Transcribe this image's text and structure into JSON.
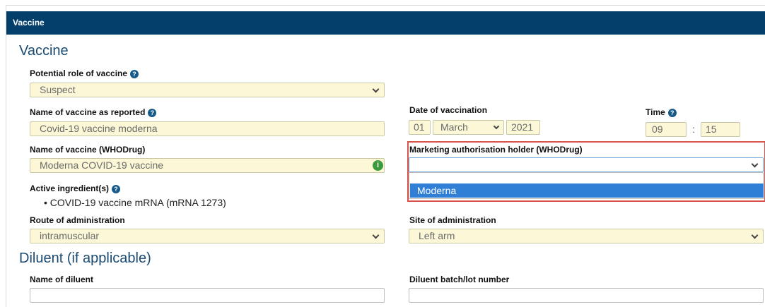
{
  "panel": {
    "header": "Vaccine"
  },
  "vaccine_section": {
    "title": "Vaccine",
    "role": {
      "label": "Potential role of vaccine",
      "value": "Suspect"
    },
    "name_reported": {
      "label": "Name of vaccine as reported",
      "value": "Covid-19 vaccine moderna"
    },
    "name_whodrug": {
      "label": "Name of vaccine (WHODrug)",
      "value": "Moderna COVID-19 vaccine"
    },
    "active_ingredients": {
      "label": "Active ingredient(s)",
      "items": [
        "COVID-19 vaccine mRNA (mRNA 1273)"
      ]
    },
    "route": {
      "label": "Route of administration",
      "value": "intramuscular"
    },
    "date": {
      "label": "Date of vaccination",
      "day": "01",
      "month": "March",
      "year": "2021"
    },
    "time": {
      "label": "Time",
      "hour": "09",
      "separator": ":",
      "minute": "15"
    },
    "mah": {
      "label": "Marketing authorisation holder (WHODrug)",
      "value": "",
      "options": [
        "Moderna"
      ]
    },
    "site": {
      "label": "Site of administration",
      "value": "Left arm"
    }
  },
  "diluent_section": {
    "title": "Diluent (if applicable)",
    "name": {
      "label": "Name of diluent",
      "value": ""
    },
    "batch": {
      "label": "Diluent batch/lot number",
      "value": ""
    }
  },
  "icons": {
    "help": "question-circle-icon",
    "info": "info-circle-icon",
    "dropdown": "chevron-down-icon"
  },
  "colors": {
    "header_bg": "#043e6b",
    "field_bg": "#fcf8d7",
    "highlight_border": "#d9534f",
    "option_selected": "#2f7fd6"
  }
}
